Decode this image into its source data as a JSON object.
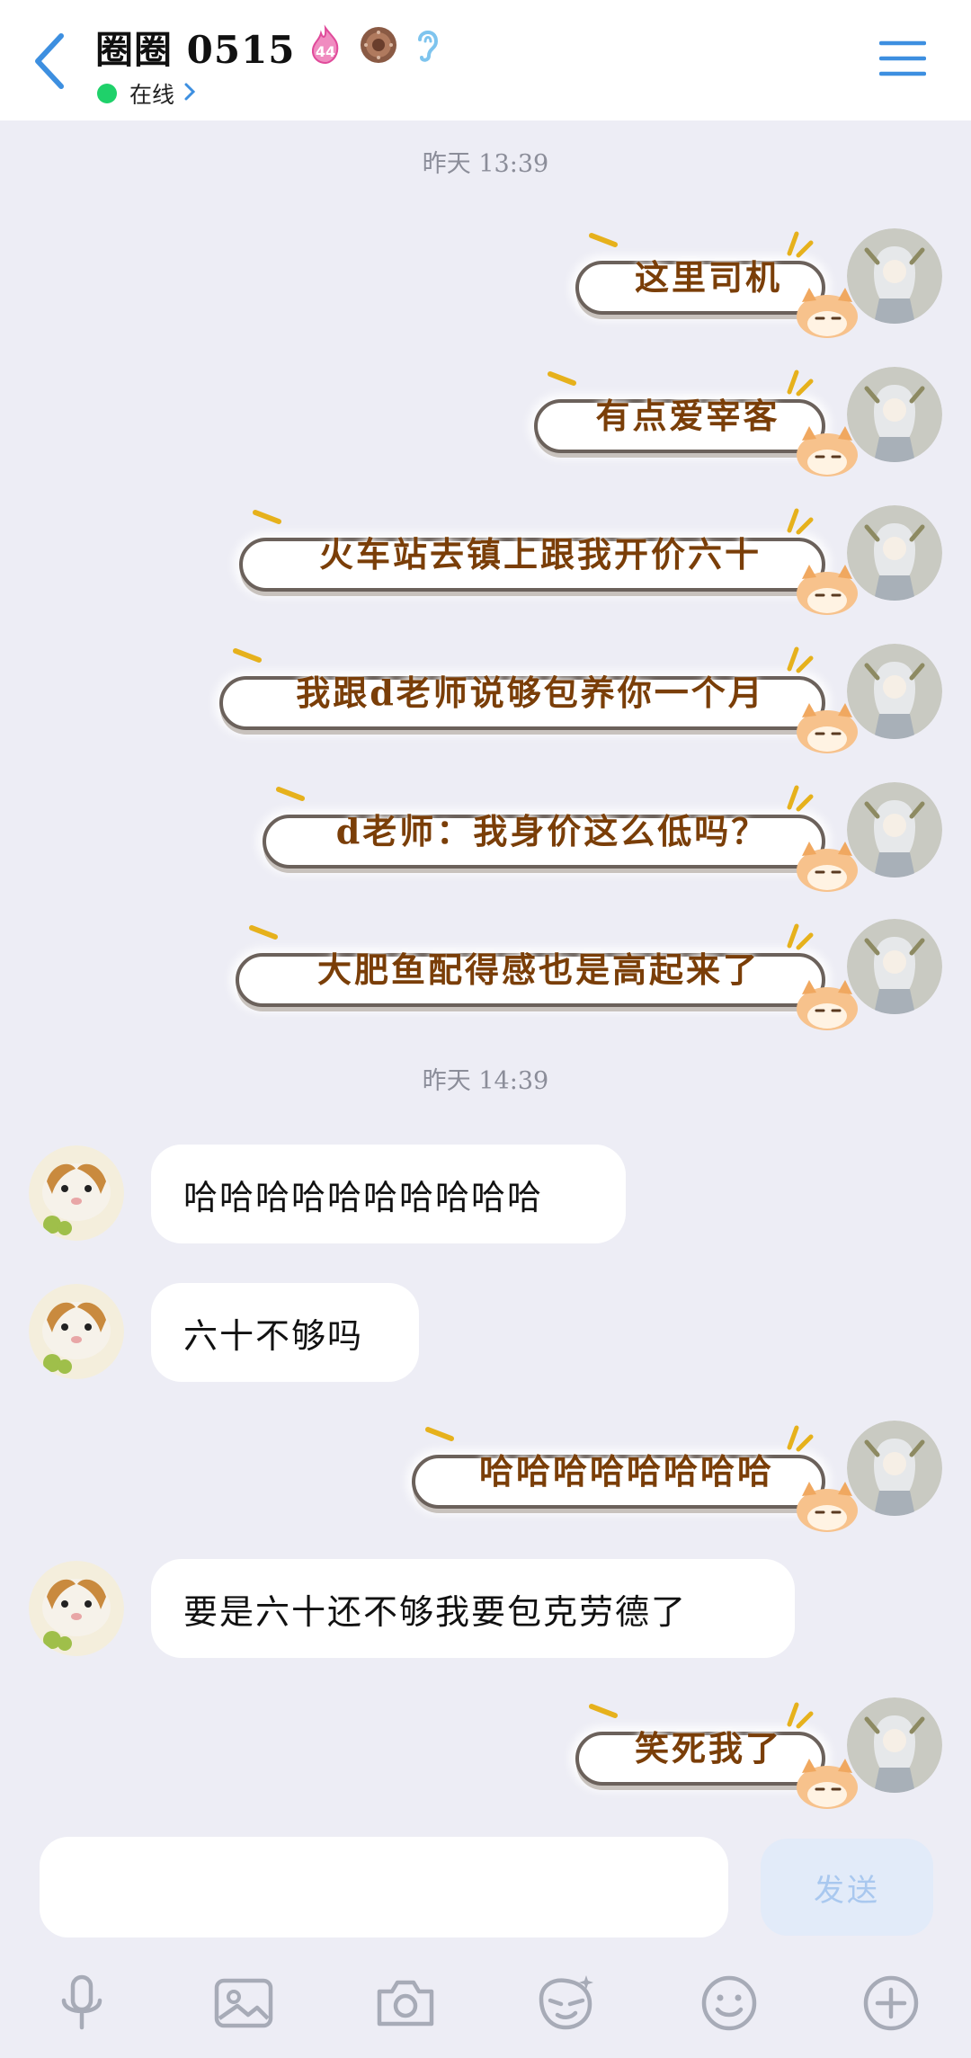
{
  "header": {
    "title": "圈圈 0515",
    "status": "在线",
    "level_badge": "44"
  },
  "messages": [
    {
      "type": "timestamp",
      "text": "昨天 13:39"
    },
    {
      "type": "sent",
      "text": "这里司机"
    },
    {
      "type": "sent",
      "text": "有点爱宰客"
    },
    {
      "type": "sent",
      "text": "火车站去镇上跟我开价六十"
    },
    {
      "type": "sent",
      "text": "我跟d老师说够包养你一个月"
    },
    {
      "type": "sent",
      "text": "d老师：我身价这么低吗？"
    },
    {
      "type": "sent",
      "text": "大肥鱼配得感也是高起来了"
    },
    {
      "type": "timestamp",
      "text": "昨天 14:39"
    },
    {
      "type": "received",
      "text": "哈哈哈哈哈哈哈哈哈哈"
    },
    {
      "type": "received",
      "text": "六十不够吗"
    },
    {
      "type": "sent",
      "text": "哈哈哈哈哈哈哈哈"
    },
    {
      "type": "received",
      "text": "要是六十还不够我要包克劳德了"
    },
    {
      "type": "sent",
      "text": "笑死我了"
    }
  ],
  "input": {
    "value": "",
    "send_label": "发送"
  },
  "toolbar": {
    "icons": [
      "microphone-icon",
      "image-icon",
      "camera-icon",
      "emoji-face-icon",
      "smile-icon",
      "plus-circle-icon"
    ]
  },
  "colors": {
    "accent": "#3d8fe0",
    "online": "#1fd16a",
    "sent_text": "#7a3e08",
    "background": "#ededf5",
    "send_button_bg": "#e2ebf9"
  }
}
